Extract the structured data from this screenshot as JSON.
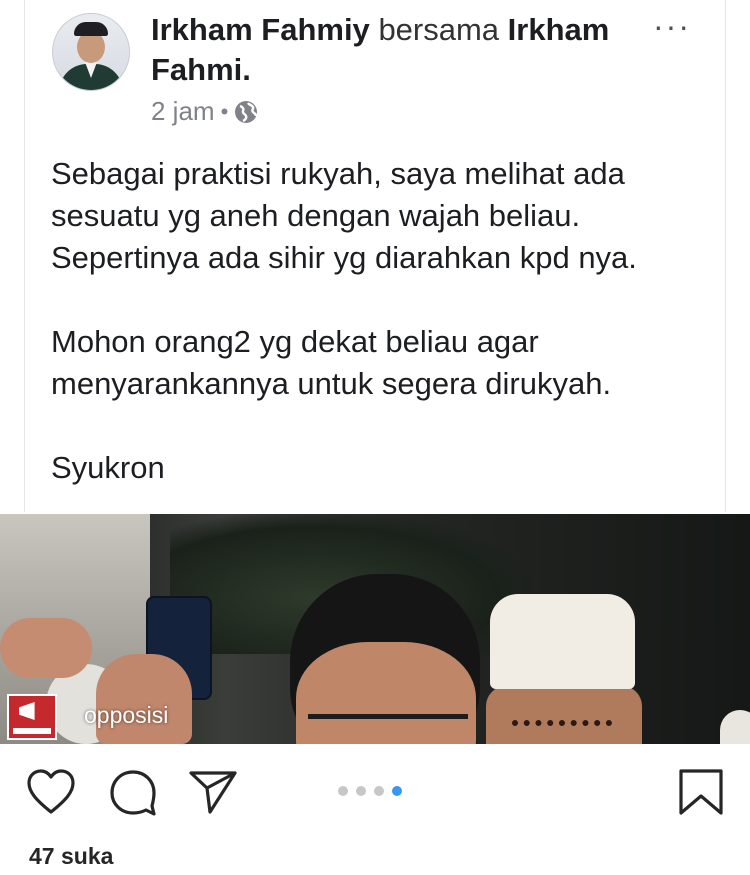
{
  "fb_post": {
    "author": "Irkham Fahmiy",
    "with_word": "bersama",
    "tagged": "Irkham Fahmi.",
    "time": "2 jam",
    "separator": "•",
    "paragraph1": [
      "Sebagai praktisi rukyah, saya melihat ada",
      "sesuatu yg aneh dengan wajah beliau.",
      "Sepertinya ada sihir yg diarahkan kpd nya."
    ],
    "paragraph2": [
      "Mohon orang2 yg dekat beliau agar",
      "menyarankannya untuk segera dirukyah."
    ],
    "closing": "Syukron",
    "more_icon": "ellipsis-icon",
    "privacy_icon": "globe-icon"
  },
  "photo": {
    "watermark": "opposisi",
    "logo_text": "OPPOSISI"
  },
  "instagram": {
    "likes": "47 suka",
    "carousel": {
      "total": 4,
      "active_index": 3
    },
    "icons": [
      "heart-icon",
      "comment-icon",
      "share-icon",
      "save-icon"
    ],
    "accent": "#3897f0"
  }
}
